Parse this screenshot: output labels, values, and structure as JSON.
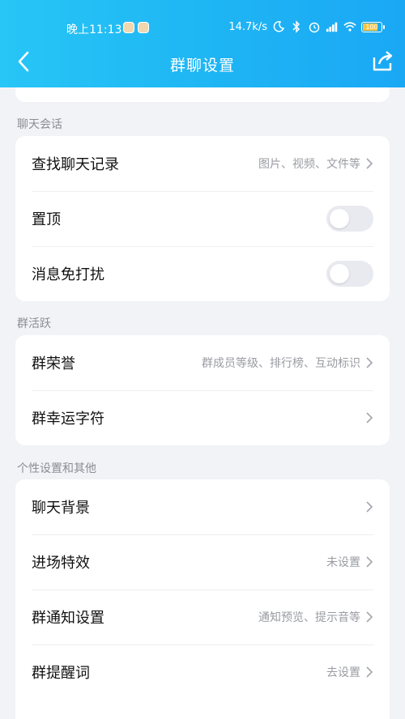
{
  "status_bar": {
    "time": "晚上11:13",
    "network_speed": "14.7k/s",
    "battery": "100"
  },
  "nav": {
    "title": "群聊设置"
  },
  "sections": {
    "chat_session": {
      "title": "聊天会话",
      "find_history": {
        "label": "查找聊天记录",
        "value": "图片、视频、文件等"
      },
      "pin": {
        "label": "置顶",
        "on": false
      },
      "mute": {
        "label": "消息免打扰",
        "on": false
      }
    },
    "group_activity": {
      "title": "群活跃",
      "honor": {
        "label": "群荣誉",
        "value": "群成员等级、排行榜、互动标识"
      },
      "lucky_char": {
        "label": "群幸运字符"
      }
    },
    "personal": {
      "title": "个性设置和其他",
      "chat_background": {
        "label": "聊天背景"
      },
      "entry_effect": {
        "label": "进场特效",
        "value": "未设置"
      },
      "notify_settings": {
        "label": "群通知设置",
        "value": "通知预览、提示音等"
      },
      "reminder_words": {
        "label": "群提醒词",
        "value": "去设置"
      }
    }
  },
  "colors": {
    "header_start": "#27c6f6",
    "header_end": "#1aa8f5",
    "background": "#f2f3f6"
  }
}
